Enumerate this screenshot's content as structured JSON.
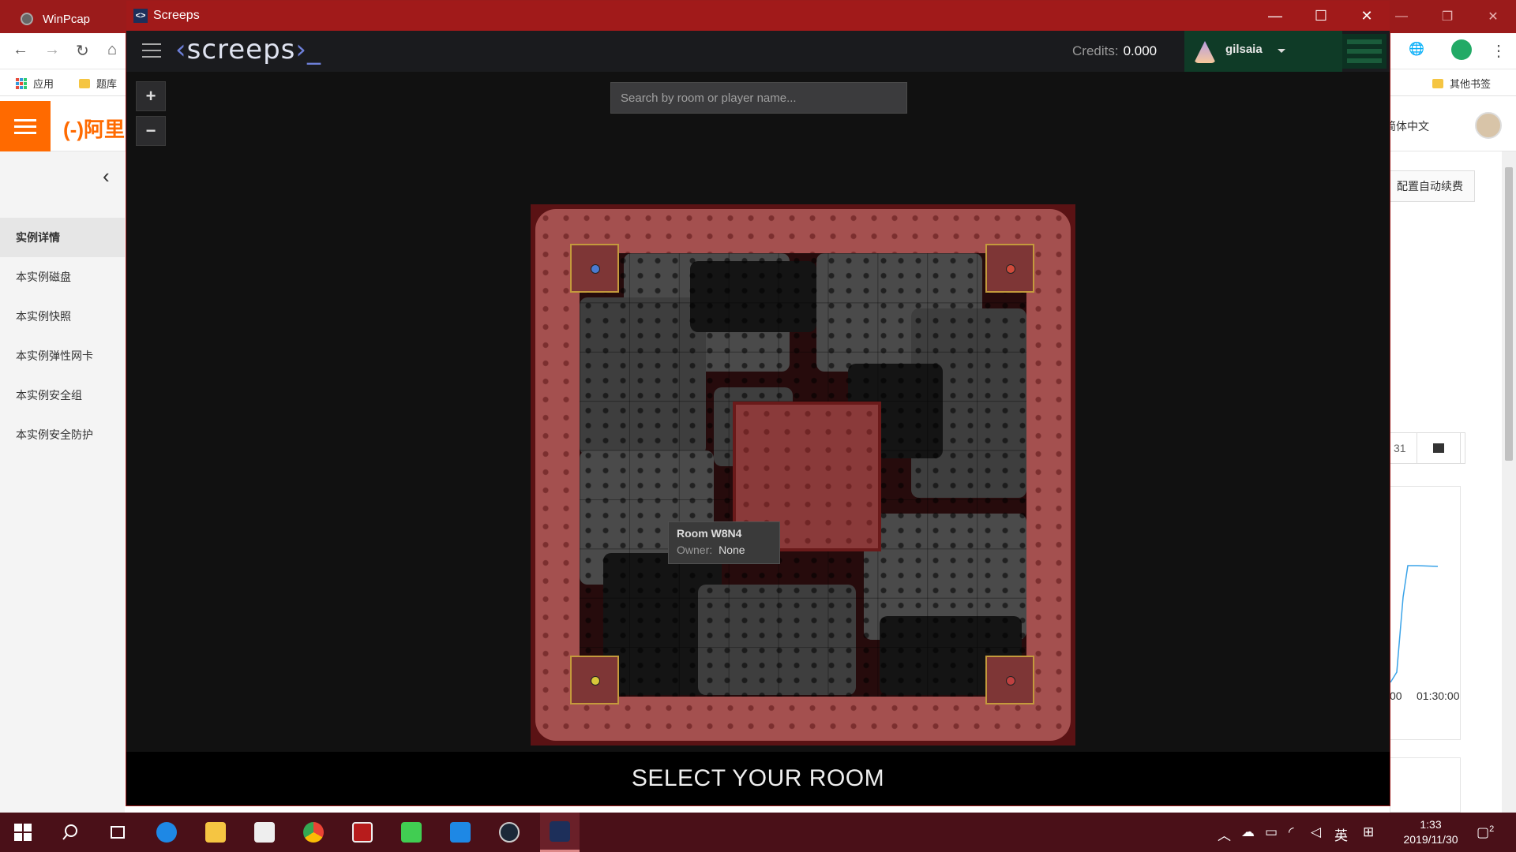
{
  "background_browser": {
    "tab_title": "WinPcap",
    "bookmarks": {
      "apps": "应用",
      "quiz": "题库",
      "other": "其他书签"
    },
    "site_logo": "(-)阿里",
    "lang": "简体中文",
    "side_menu": [
      "实例详情",
      "本实例磁盘",
      "本实例快照",
      "本实例弹性网卡",
      "本实例安全组",
      "本实例安全防护"
    ],
    "right_button": "配置自动续费",
    "date_fragment": "31",
    "chart_tick_1": "00",
    "chart_tick_2": "01:30:00"
  },
  "window": {
    "title": "Screeps",
    "controls": {
      "minimize": "—",
      "maximize": "☐",
      "close": "✕"
    }
  },
  "header": {
    "logo_left": "‹",
    "logo_text": "screeps",
    "logo_right": "›_",
    "credits_label": "Credits:",
    "credits_value": "0.000",
    "username": "gilsaia"
  },
  "map_controls": {
    "zoom_in": "+",
    "zoom_out": "−"
  },
  "search": {
    "placeholder": "Search by room or player name..."
  },
  "tooltip": {
    "room": "Room W8N4",
    "owner_label": "Owner:",
    "owner_value": "None"
  },
  "footer": {
    "title": "SELECT YOUR ROOM"
  },
  "corner_rooms": [
    {
      "position": "top-left",
      "orb_color": "#4a7bd0"
    },
    {
      "position": "top-right",
      "orb_color": "#d04a3a"
    },
    {
      "position": "bottom-left",
      "orb_color": "#d8c83a"
    },
    {
      "position": "bottom-right",
      "orb_color": "#c04040"
    }
  ],
  "taskbar": {
    "time": "1:33",
    "date": "2019/11/30",
    "ime": "英",
    "notifications": "2",
    "apps": [
      "start",
      "search",
      "task-view",
      "edge",
      "file-explorer",
      "store",
      "chrome",
      "acrobat",
      "qt-creator",
      "vscode",
      "steam",
      "screeps"
    ]
  }
}
